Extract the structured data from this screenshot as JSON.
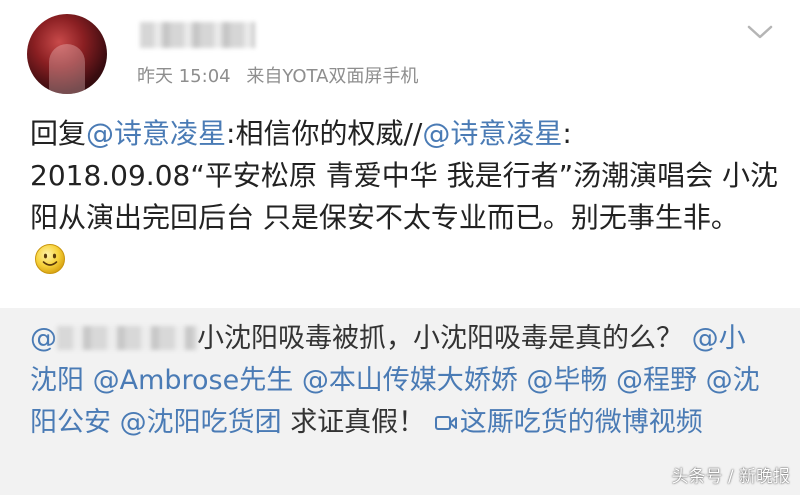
{
  "header": {
    "time": "昨天 15:04",
    "source": "来自YOTA双面屏手机"
  },
  "post": {
    "segments": [
      {
        "text": "回复",
        "type": "plain"
      },
      {
        "text": "@诗意凌星",
        "type": "mention"
      },
      {
        "text": ":相信你的权威//",
        "type": "plain"
      },
      {
        "text": "@诗意凌星",
        "type": "mention"
      },
      {
        "text": ":",
        "type": "plain"
      },
      {
        "text": "2018.09.08“平安松原 青爱中华 我是行者”汤潮演唱会 小沈阳从演出完回后台 只是保安不太专业而已。别无事生非。",
        "type": "plain"
      }
    ]
  },
  "repost": {
    "prefix": "@",
    "text1": "小沈阳吸毒被抓，小沈阳吸毒是真的么？",
    "mentions": [
      "@小沈阳",
      "@Ambrose先生",
      "@本山传媒大娇娇",
      "@毕畅",
      "@程野",
      "@沈阳公安",
      "@沈阳吃货团"
    ],
    "suffix": "求证真假！",
    "video_link": "这厮吃货的微博视频"
  },
  "watermark": "头条号 / 新晚报",
  "icons": [
    "chevron-down-icon",
    "smiley-icon",
    "video-icon"
  ],
  "colors": {
    "link": "#4a7bb5",
    "meta": "#8e8e8e",
    "repost_bg": "#f2f2f2"
  }
}
